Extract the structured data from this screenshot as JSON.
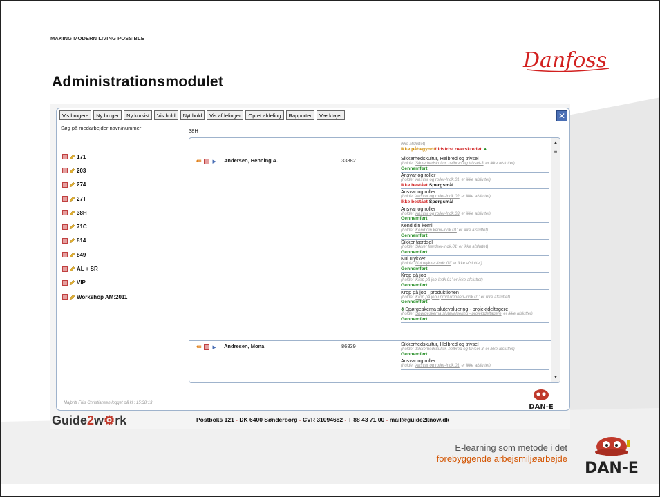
{
  "slide": {
    "tagline": "MAKING MODERN LIVING POSSIBLE",
    "brand": "Danfoss",
    "title": "Administrationsmodulet"
  },
  "toolbar": {
    "buttons": [
      "Vis brugere",
      "Ny bruger",
      "Ny kursist",
      "Vis hold",
      "Nyt hold",
      "Vis afdelinger",
      "Opret afdeling",
      "Rapporter",
      "Værktøjer"
    ],
    "close_label": "✕"
  },
  "search": {
    "label": "Søg på medarbejder navn/nummer",
    "value": ""
  },
  "groups": [
    "171",
    "203",
    "274",
    "27T",
    "38H",
    "71C",
    "814",
    "849",
    "AL + SR",
    "VIP",
    "Workshop AM:2011"
  ],
  "selected_group": "38H",
  "top_partial": {
    "hint": "ikke afsluttet)",
    "status_a": "Ikke påbegyndt",
    "status_b": "/tidsfrist overskredet"
  },
  "people": [
    {
      "name": "Andersen, Henning A.",
      "number": "33882",
      "courses": [
        {
          "name": "Sikkerhedskultur, Helbred og trivsel",
          "hint_pre": "(holdet '",
          "hint_link": "Sikkerhedskultur, helbred og trivsel-3",
          "hint_post": "' er ikke afsluttet)",
          "status": "Gennemført",
          "status_extra": ""
        },
        {
          "name": "Ansvar og roller",
          "hint_pre": "(holdet '",
          "hint_link": "Ansvar og roller-Indk.01",
          "hint_post": "' er ikke afsluttet)",
          "status": "Ikke bestået",
          "status_extra": " Spørgsmål"
        },
        {
          "name": "Ansvar og roller",
          "hint_pre": "(holdet '",
          "hint_link": "Ansvar og roller-Indk.02",
          "hint_post": "' er ikke afsluttet)",
          "status": "Ikke bestået",
          "status_extra": " Spørgsmål"
        },
        {
          "name": "Ansvar og roller",
          "hint_pre": "(holdet '",
          "hint_link": "Ansvar og roller-Indk.03",
          "hint_post": "' er ikke afsluttet)",
          "status": "Gennemført",
          "status_extra": ""
        },
        {
          "name": "Kend din kemi",
          "hint_pre": "(holdet '",
          "hint_link": "Kend din kemi-Indk.01",
          "hint_post": "' er ikke afsluttet)",
          "status": "Gennemført",
          "status_extra": ""
        },
        {
          "name": "Sikker færdsel",
          "hint_pre": "(holdet '",
          "hint_link": "Sikker færdsel-Indk.01",
          "hint_post": "' er ikke afsluttet)",
          "status": "Gennemført",
          "status_extra": ""
        },
        {
          "name": "Nul ulykker",
          "hint_pre": "(holdet '",
          "hint_link": "Nul ulykker-Indk.01",
          "hint_post": "' er ikke afsluttet)",
          "status": "Gennemført",
          "status_extra": ""
        },
        {
          "name": "Krop på job",
          "hint_pre": "(holdet '",
          "hint_link": "Krop på job-Indk.01",
          "hint_post": "' er ikke afsluttet)",
          "status": "Gennemført",
          "status_extra": ""
        },
        {
          "name": "Krop på job i produktionen",
          "hint_pre": "(holdet '",
          "hint_link": "Krop på job i produktionen-Indk.01",
          "hint_post": "' er ikke afsluttet)",
          "status": "Gennemført",
          "status_extra": ""
        },
        {
          "name": "Spørgeskema slutevaluering - projektdeltagere",
          "hint_pre": "(holdet '",
          "hint_link": "Spørgeskema slutevaluering - projektdeltagere",
          "hint_post": "' er ikke afsluttet)",
          "status": "Gennemført",
          "status_extra": ""
        }
      ]
    },
    {
      "name": "Andresen, Mona",
      "number": "86839",
      "courses": [
        {
          "name": "Sikkerhedskultur, Helbred og trivsel",
          "hint_pre": "(holdet '",
          "hint_link": "Sikkerhedskultur, helbred og trivsel-3",
          "hint_post": "' er ikke afsluttet)",
          "status": "Gennemført",
          "status_extra": ""
        },
        {
          "name": "Ansvar og roller",
          "hint_pre": "(holdet '",
          "hint_link": "Ansvar og roller-Indk.01",
          "hint_post": "' er ikke afsluttet)",
          "status": "",
          "status_extra": ""
        }
      ]
    }
  ],
  "logged_in": "Majbritt Friis Christiansen logget på kl.: 15:38:13",
  "footer": {
    "logo_a": "Guide",
    "logo_b": "2",
    "logo_c": "w",
    "logo_d": "rk",
    "address_1": "Postboks 121",
    "address_2": "DK 6400 Sønderborg",
    "address_3": "CVR 31094682",
    "address_4": "T 88 43 71 00",
    "address_5": "mail@guide2know.dk",
    "sep": " - "
  },
  "dane_label": "DAN-E",
  "elearning": {
    "line1": "E-learning som metode i det",
    "line2": "forebyggende arbejsmiljøarbejde"
  },
  "colors": {
    "danfoss_red": "#d2201f",
    "status_green": "#2a8f2a",
    "status_red": "#d02020",
    "status_orange": "#d08a00",
    "frame_blue": "#9fb3cc"
  }
}
